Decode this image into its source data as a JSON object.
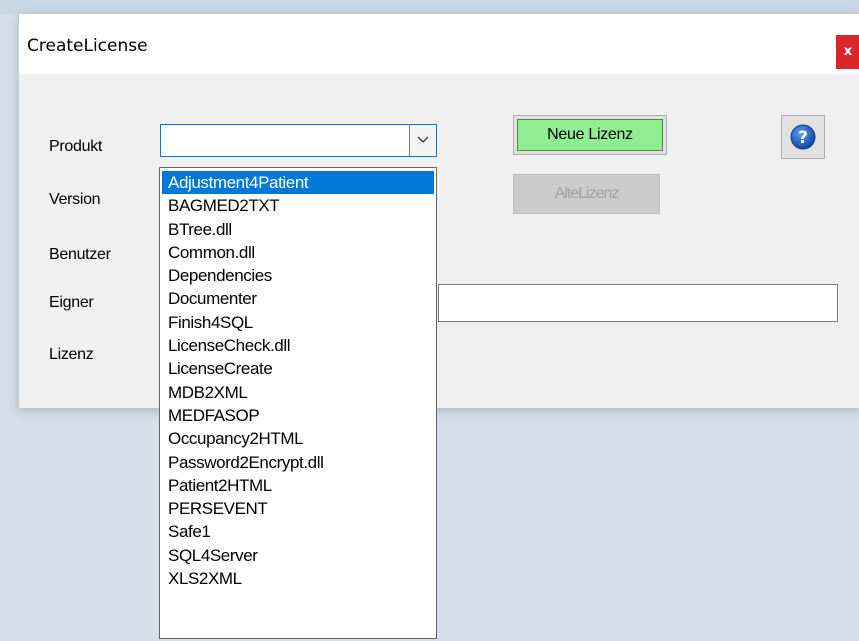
{
  "window": {
    "title": "CreateLicense",
    "close_label": "x"
  },
  "form": {
    "labels": {
      "product": "Produkt",
      "version": "Version",
      "user": "Benutzer",
      "owner": "Eigner",
      "license": "Lizenz"
    },
    "product_value": "",
    "owner_value": ""
  },
  "buttons": {
    "new_license": "Neue Lizenz",
    "old_license": "AlteLizenz",
    "help_icon": "help-question-icon"
  },
  "colors": {
    "new_license_bg": "#90ee90",
    "selection": "#0078d7",
    "close": "#d9262d",
    "help": "#1a63c6"
  },
  "dropdown": {
    "selected_index": 0,
    "items": [
      "Adjustment4Patient",
      "BAGMED2TXT",
      "BTree.dll",
      "Common.dll",
      "Dependencies",
      "Documenter",
      "Finish4SQL",
      "LicenseCheck.dll",
      "LicenseCreate",
      "MDB2XML",
      "MEDFASOP",
      "Occupancy2HTML",
      "Password2Encrypt.dll",
      "Patient2HTML",
      "PERSEVENT",
      "Safe1",
      "SQL4Server",
      "XLS2XML"
    ]
  }
}
